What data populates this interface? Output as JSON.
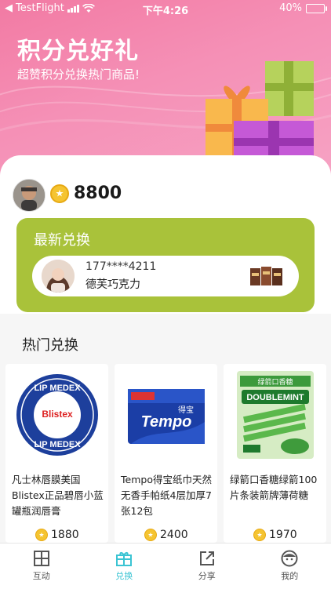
{
  "status_bar": {
    "carrier": "TestFlight",
    "time": "下午4:26",
    "battery": "40%",
    "battery_level": 0.4
  },
  "header": {
    "title": "积分兑好礼",
    "subtitle": "超赞积分兑换热门商品!"
  },
  "user": {
    "points": "8800",
    "coin_icon": "coin-icon"
  },
  "latest": {
    "title": "最新兑换",
    "record": {
      "phone": "177****4211",
      "product": "德芙巧克力"
    }
  },
  "hot": {
    "title": "热门兑换",
    "items": [
      {
        "name": "凡士林唇膜美国Blistex正品碧唇小蓝罐瓶润唇膏",
        "price": "1880",
        "logo_top": "LIP MEDEX",
        "logo_brand": "Blistex",
        "logo_bottom": "LIP MEDEX"
      },
      {
        "name": "Tempo得宝纸巾天然无香手帕纸4层加厚7张12包",
        "price": "2400",
        "logo_brand": "Tempo",
        "logo_cn": "得宝"
      },
      {
        "name": "绿箭口香糖绿箭100片条装箭牌薄荷糖",
        "price": "1970",
        "logo_cn": "绿箭口香糖",
        "logo_brand": "DOUBLEMINT"
      }
    ]
  },
  "tabbar": [
    {
      "label": "互动",
      "icon": "grid-icon",
      "active": false
    },
    {
      "label": "兑换",
      "icon": "gift-icon",
      "active": true
    },
    {
      "label": "分享",
      "icon": "share-icon",
      "active": false
    },
    {
      "label": "我的",
      "icon": "profile-icon",
      "active": false
    }
  ],
  "colors": {
    "header_pink": "#f27aa3",
    "card_green": "#a9c23a",
    "coin_gold": "#f5c431",
    "tab_active": "#3bc4d3"
  }
}
